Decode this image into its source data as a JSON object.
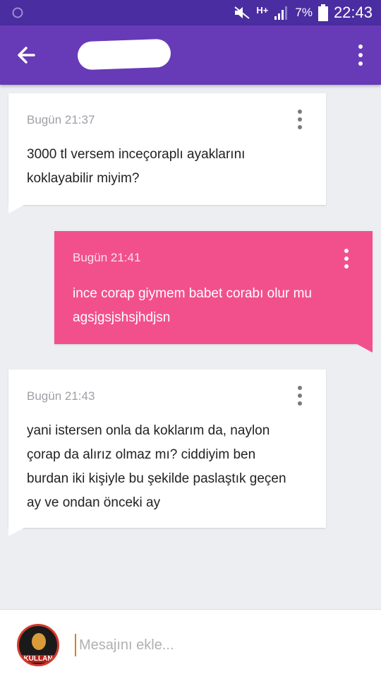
{
  "status_bar": {
    "network": "H+",
    "battery": "7%",
    "time": "22:43"
  },
  "header": {
    "contact_name": ""
  },
  "messages": [
    {
      "direction": "in",
      "time": "Bugün 21:37",
      "text": "3000 tl versem inceçoraplı ayaklarını koklayabilir miyim?"
    },
    {
      "direction": "out",
      "time": "Bugün 21:41",
      "text": "ince corap giymem babet corabı olur mu agsjgsjshsjhdjsn"
    },
    {
      "direction": "in",
      "time": "Bugün 21:43",
      "text": "yani istersen onla da koklarım da, naylon çorap da alırız olmaz mı? ciddiyim ben burdan iki kişiyle bu şekilde paslaştık geçen ay ve ondan önceki ay"
    }
  ],
  "composer": {
    "placeholder": "Mesajını ekle...",
    "avatar_logo_text": "KULLAN"
  },
  "colors": {
    "app_bar": "#673ab7",
    "status_bar": "#4a2da0",
    "outgoing_bubble": "#f2508c",
    "incoming_bubble": "#ffffff"
  }
}
